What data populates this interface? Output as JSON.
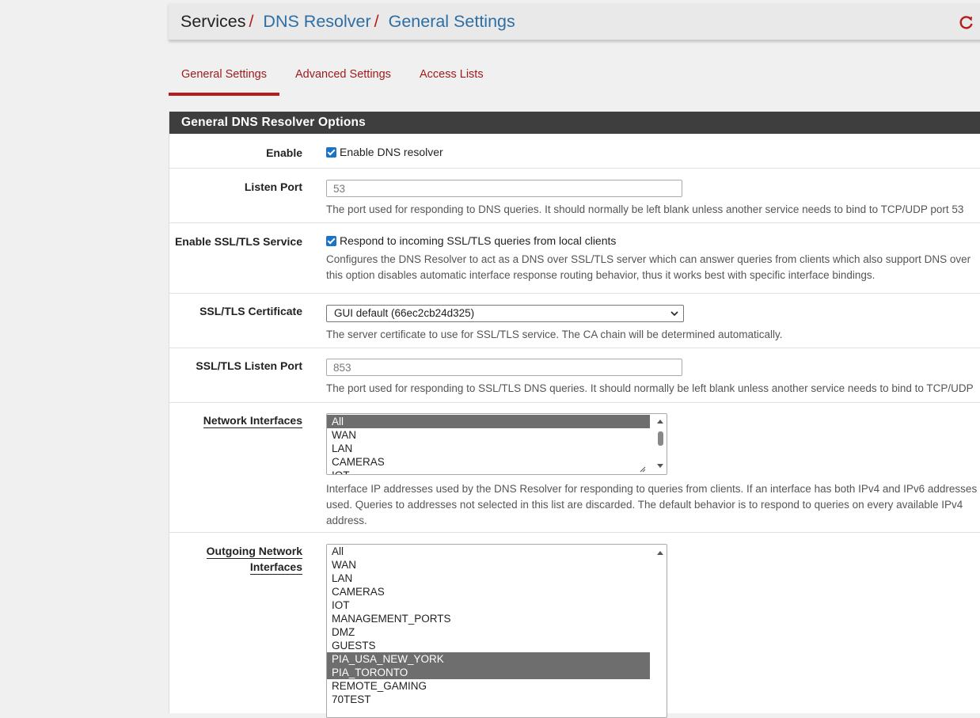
{
  "breadcrumb": {
    "root": "Services",
    "section": "DNS Resolver",
    "current": "General Settings",
    "separator": "/"
  },
  "tabs": [
    {
      "label": "General Settings",
      "active": true
    },
    {
      "label": "Advanced Settings",
      "active": false
    },
    {
      "label": "Access Lists",
      "active": false
    }
  ],
  "panel": {
    "title": "General DNS Resolver Options"
  },
  "enable": {
    "label": "Enable",
    "checkbox_label": "Enable DNS resolver",
    "checked": true
  },
  "listen_port": {
    "label": "Listen Port",
    "placeholder": "53",
    "help": "The port used for responding to DNS queries. It should normally be left blank unless another service needs to bind to TCP/UDP port 53"
  },
  "ssl_service": {
    "label": "Enable SSL/TLS Service",
    "checkbox_label": "Respond to incoming SSL/TLS queries from local clients",
    "checked": true,
    "help_line1": "Configures the DNS Resolver to act as a DNS over SSL/TLS server which can answer queries from clients which also support DNS over",
    "help_line2": "this option disables automatic interface response routing behavior, thus it works best with specific interface bindings."
  },
  "ssl_cert": {
    "label": "SSL/TLS Certificate",
    "selected": "GUI default (66ec2cb24d325)",
    "help": "The server certificate to use for SSL/TLS service. The CA chain will be determined automatically."
  },
  "ssl_port": {
    "label": "SSL/TLS Listen Port",
    "placeholder": "853",
    "help": "The port used for responding to SSL/TLS DNS queries. It should normally be left blank unless another service needs to bind to TCP/UDP"
  },
  "network_interfaces": {
    "label": "Network Interfaces",
    "options": [
      {
        "label": "All",
        "selected": true
      },
      {
        "label": "WAN",
        "selected": false
      },
      {
        "label": "LAN",
        "selected": false
      },
      {
        "label": "CAMERAS",
        "selected": false
      },
      {
        "label": "IOT",
        "selected": false
      }
    ],
    "help_line1": "Interface IP addresses used by the DNS Resolver for responding to queries from clients. If an interface has both IPv4 and IPv6 addresses",
    "help_line2": "used. Queries to addresses not selected in this list are discarded. The default behavior is to respond to queries on every available IPv4",
    "help_line3": "address."
  },
  "outgoing_interfaces": {
    "label_line1": "Outgoing Network",
    "label_line2": "Interfaces",
    "options": [
      {
        "label": "All",
        "selected": false
      },
      {
        "label": "WAN",
        "selected": false
      },
      {
        "label": "LAN",
        "selected": false
      },
      {
        "label": "CAMERAS",
        "selected": false
      },
      {
        "label": "IOT",
        "selected": false
      },
      {
        "label": "MANAGEMENT_PORTS",
        "selected": false
      },
      {
        "label": "DMZ",
        "selected": false
      },
      {
        "label": "GUESTS",
        "selected": false
      },
      {
        "label": "PIA_USA_NEW_YORK",
        "selected": true
      },
      {
        "label": "PIA_TORONTO",
        "selected": true
      },
      {
        "label": "REMOTE_GAMING",
        "selected": false
      },
      {
        "label": "70TEST",
        "selected": false
      }
    ]
  },
  "colors": {
    "accent_red": "#b71c1c",
    "link_blue": "#2d6ea5",
    "panel_heading": "#3e3e3e",
    "checkbox_blue": "#1a73c7",
    "selected_option": "#6e6e6e"
  },
  "icons": {
    "reload": "reload-icon",
    "chevron": "chevron-down-icon"
  }
}
